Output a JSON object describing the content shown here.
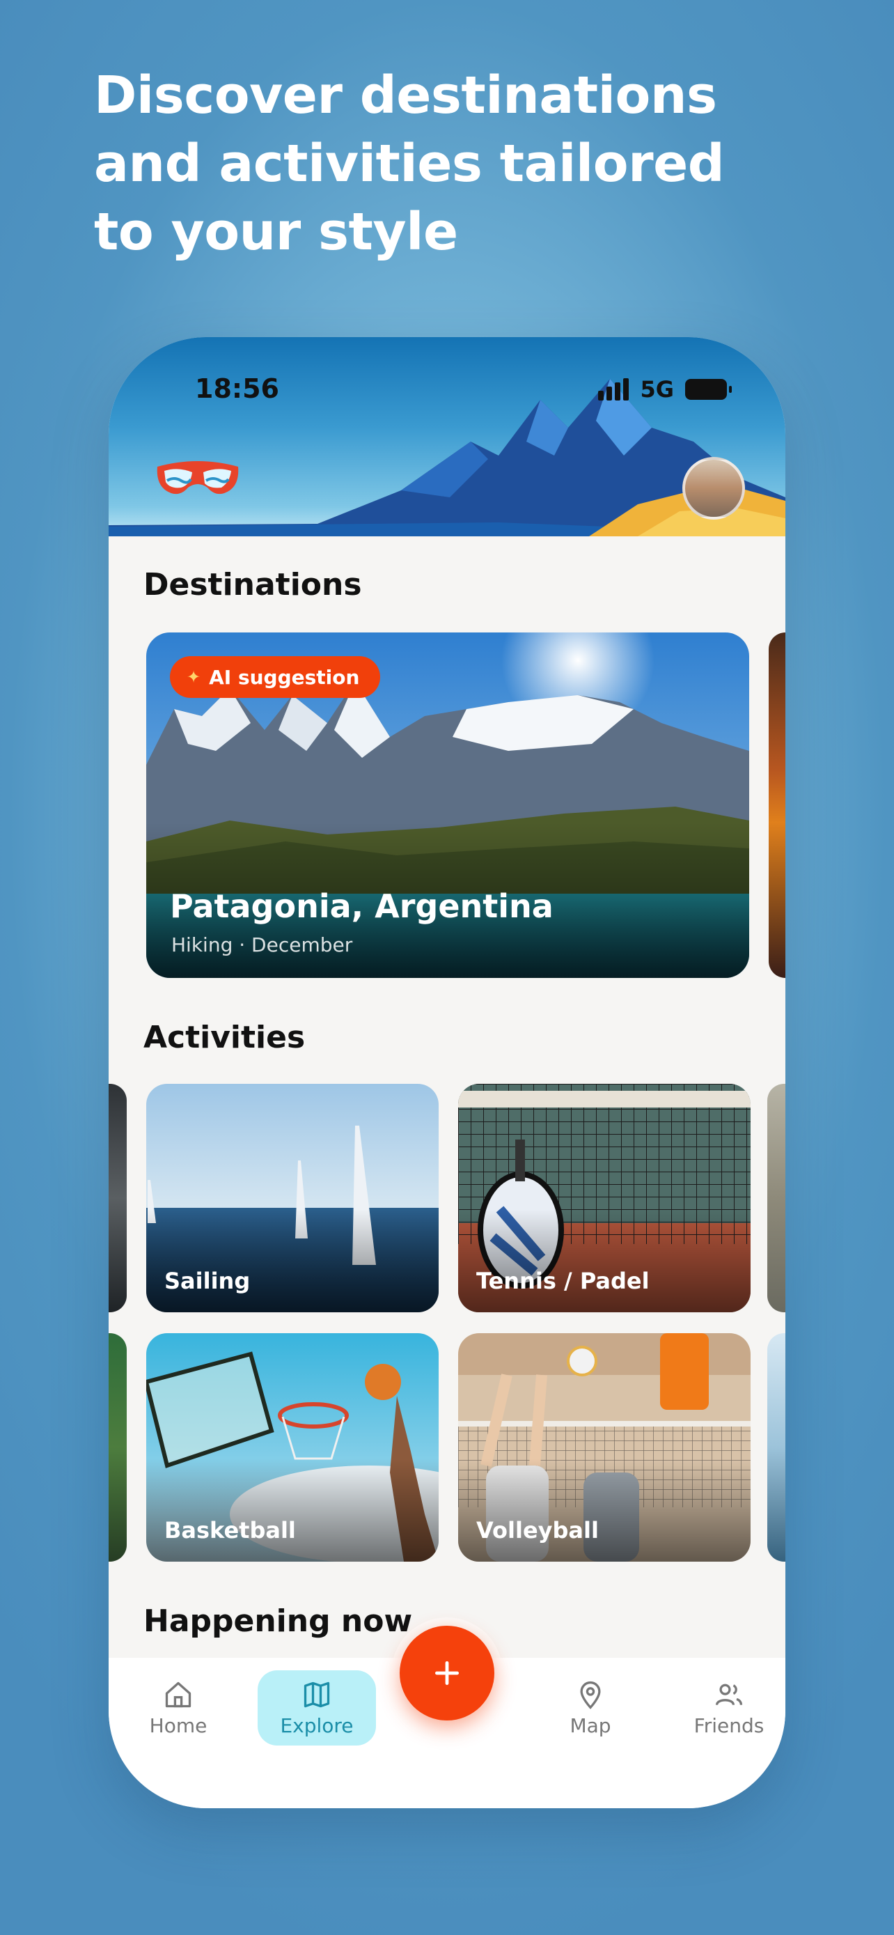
{
  "headline": {
    "line1": "Discover destinations",
    "line2": "and activities tailored",
    "line3": "to your style"
  },
  "status_bar": {
    "time": "18:56",
    "network": "5G"
  },
  "sections": {
    "destinations": "Destinations",
    "activities": "Activities",
    "happening_now": "Happening now"
  },
  "destination_card": {
    "badge": "AI suggestion",
    "title": "Patagonia, Argentina",
    "subtitle": "Hiking · December"
  },
  "activities": [
    {
      "label": "Sailing"
    },
    {
      "label": "Tennis / Padel"
    },
    {
      "label": "Basketball"
    },
    {
      "label": "Volleyball"
    }
  ],
  "nav": {
    "home": "Home",
    "explore": "Explore",
    "map": "Map",
    "friends": "Friends",
    "active": "explore"
  },
  "colors": {
    "accent": "#f5410c",
    "nav_active_bg": "#b9f0f8",
    "nav_active_text": "#1b8ea8",
    "page_bg": "#4a8dbd"
  },
  "icons": {
    "logo": "goggles-logo-icon",
    "home": "home-icon",
    "explore": "map-folded-icon",
    "map": "map-pin-icon",
    "friends": "users-icon",
    "fab": "plus-icon",
    "badge": "sparkle-icon"
  }
}
